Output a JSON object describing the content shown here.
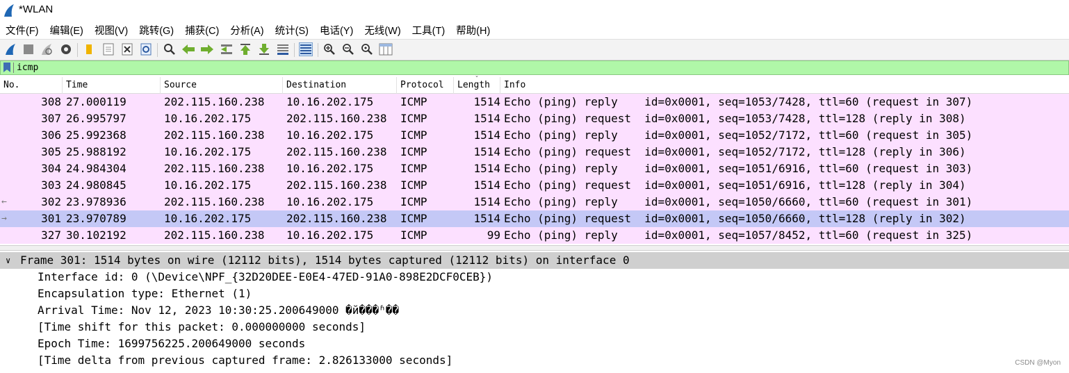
{
  "window": {
    "title": "*WLAN"
  },
  "menu": [
    {
      "label": "文件(F)"
    },
    {
      "label": "编辑(E)"
    },
    {
      "label": "视图(V)"
    },
    {
      "label": "跳转(G)"
    },
    {
      "label": "捕获(C)"
    },
    {
      "label": "分析(A)"
    },
    {
      "label": "统计(S)"
    },
    {
      "label": "电话(Y)"
    },
    {
      "label": "无线(W)"
    },
    {
      "label": "工具(T)"
    },
    {
      "label": "帮助(H)"
    }
  ],
  "toolbar": {
    "icons": [
      "shark-fin-icon",
      "stop-icon",
      "restart-icon",
      "gear-icon",
      "folder-icon",
      "file-icon",
      "close-file-icon",
      "reload-icon",
      "search-icon",
      "arrow-left-icon",
      "arrow-right-icon",
      "jump-icon",
      "go-first-icon",
      "go-last-icon",
      "autoscroll-icon",
      "colorize-icon",
      "zoom-in-icon",
      "zoom-out-icon",
      "zoom-reset-icon",
      "resize-columns-icon"
    ]
  },
  "filter": {
    "value": "icmp"
  },
  "packet_list": {
    "columns": [
      "No.",
      "Time",
      "Source",
      "Destination",
      "Protocol",
      "Length",
      "Info"
    ],
    "rows": [
      {
        "no": "308",
        "time": "27.000119",
        "src": "202.115.160.238",
        "dst": "10.16.202.175",
        "proto": "ICMP",
        "len": "1514",
        "info": "Echo (ping) reply    id=0x0001, seq=1053/7428, ttl=60 (request in 307)",
        "mark": "",
        "selected": false
      },
      {
        "no": "307",
        "time": "26.995797",
        "src": "10.16.202.175",
        "dst": "202.115.160.238",
        "proto": "ICMP",
        "len": "1514",
        "info": "Echo (ping) request  id=0x0001, seq=1053/7428, ttl=128 (reply in 308)",
        "mark": "",
        "selected": false
      },
      {
        "no": "306",
        "time": "25.992368",
        "src": "202.115.160.238",
        "dst": "10.16.202.175",
        "proto": "ICMP",
        "len": "1514",
        "info": "Echo (ping) reply    id=0x0001, seq=1052/7172, ttl=60 (request in 305)",
        "mark": "",
        "selected": false
      },
      {
        "no": "305",
        "time": "25.988192",
        "src": "10.16.202.175",
        "dst": "202.115.160.238",
        "proto": "ICMP",
        "len": "1514",
        "info": "Echo (ping) request  id=0x0001, seq=1052/7172, ttl=128 (reply in 306)",
        "mark": "",
        "selected": false
      },
      {
        "no": "304",
        "time": "24.984304",
        "src": "202.115.160.238",
        "dst": "10.16.202.175",
        "proto": "ICMP",
        "len": "1514",
        "info": "Echo (ping) reply    id=0x0001, seq=1051/6916, ttl=60 (request in 303)",
        "mark": "",
        "selected": false
      },
      {
        "no": "303",
        "time": "24.980845",
        "src": "10.16.202.175",
        "dst": "202.115.160.238",
        "proto": "ICMP",
        "len": "1514",
        "info": "Echo (ping) request  id=0x0001, seq=1051/6916, ttl=128 (reply in 304)",
        "mark": "",
        "selected": false
      },
      {
        "no": "302",
        "time": "23.978936",
        "src": "202.115.160.238",
        "dst": "10.16.202.175",
        "proto": "ICMP",
        "len": "1514",
        "info": "Echo (ping) reply    id=0x0001, seq=1050/6660, ttl=60 (request in 301)",
        "mark": "←",
        "selected": false
      },
      {
        "no": "301",
        "time": "23.970789",
        "src": "10.16.202.175",
        "dst": "202.115.160.238",
        "proto": "ICMP",
        "len": "1514",
        "info": "Echo (ping) request  id=0x0001, seq=1050/6660, ttl=128 (reply in 302)",
        "mark": "→",
        "selected": true
      },
      {
        "no": "327",
        "time": "30.102192",
        "src": "202.115.160.238",
        "dst": "10.16.202.175",
        "proto": "ICMP",
        "len": "99",
        "info": "Echo (ping) reply    id=0x0001, seq=1057/8452, ttl=60 (request in 325)",
        "mark": "",
        "selected": false
      }
    ]
  },
  "details": {
    "frame_header": "Frame 301: 1514 bytes on wire (12112 bits), 1514 bytes captured (12112 bits) on interface 0",
    "lines": [
      "Interface id: 0 (\\Device\\NPF_{32D20DEE-E0E4-47ED-91A0-898E2DCF0CEB})",
      "Encapsulation type: Ethernet (1)",
      "Arrival Time: Nov 12, 2023 10:30:25.200649000 �й���ʱ��",
      "[Time shift for this packet: 0.000000000 seconds]",
      "Epoch Time: 1699756225.200649000 seconds",
      "[Time delta from previous captured frame: 2.826133000 seconds]"
    ]
  },
  "watermark": "CSDN @Myon⁠"
}
